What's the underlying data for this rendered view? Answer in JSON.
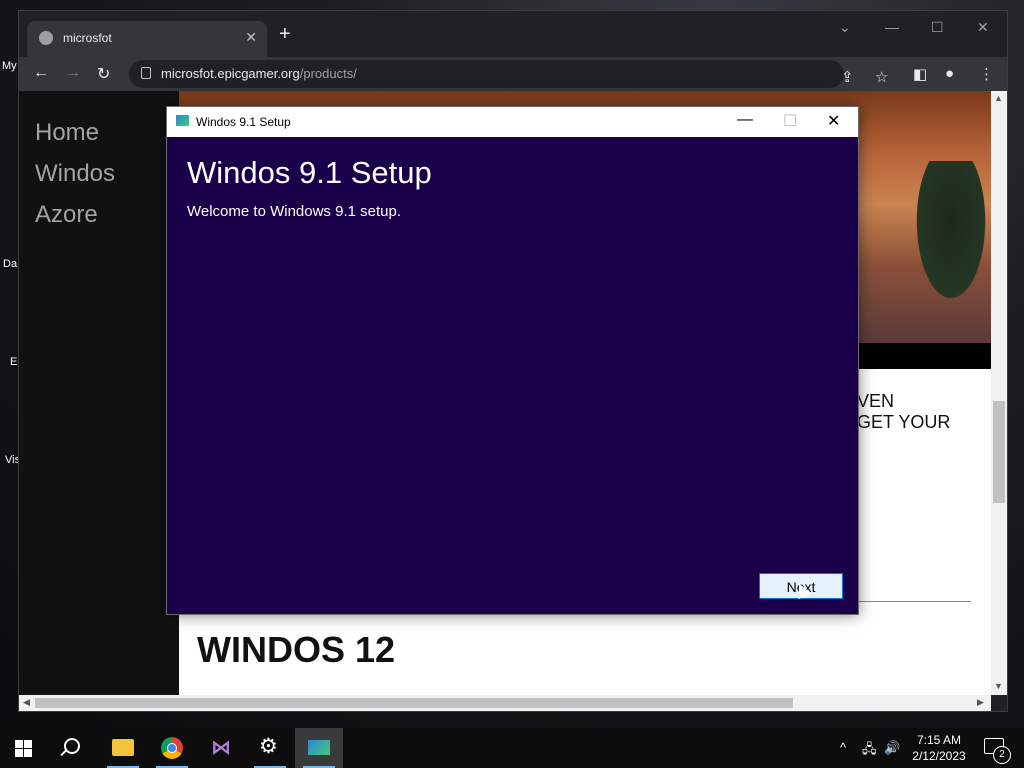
{
  "desktop": {
    "icons": [
      {
        "label": "My"
      },
      {
        "label": "Da"
      },
      {
        "label": "E"
      },
      {
        "label": "Vis"
      }
    ]
  },
  "browser": {
    "tab": {
      "title": "microsfot",
      "close": "✕"
    },
    "new_tab": "+",
    "window_controls": {
      "dropdown": "⌄",
      "minimize": "—",
      "maximize": "☐",
      "close": "✕"
    },
    "nav": {
      "back": "←",
      "forward": "→",
      "reload": "↻"
    },
    "address": {
      "domain": "microsfot.epicgamer.org",
      "path": "/products/"
    }
  },
  "page": {
    "nav_links": [
      "Home",
      "Windos",
      "Azore"
    ],
    "promo_lines": [
      "VEN",
      "GET YOUR"
    ],
    "product_heading": "WINDOS 12"
  },
  "dialog": {
    "title": "Windos 9.1 Setup",
    "heading": "Windos 9.1 Setup",
    "subtitle": "Welcome to Windows 9.1 setup.",
    "next_label": "Next",
    "controls": {
      "minimize": "—",
      "maximize": "☐",
      "close": "✕"
    }
  },
  "taskbar": {
    "clock_time": "7:15 AM",
    "clock_date": "2/12/2023",
    "notification_count": "2",
    "tray": {
      "chevron": "^",
      "network": "🖧",
      "volume": "🔊"
    }
  }
}
